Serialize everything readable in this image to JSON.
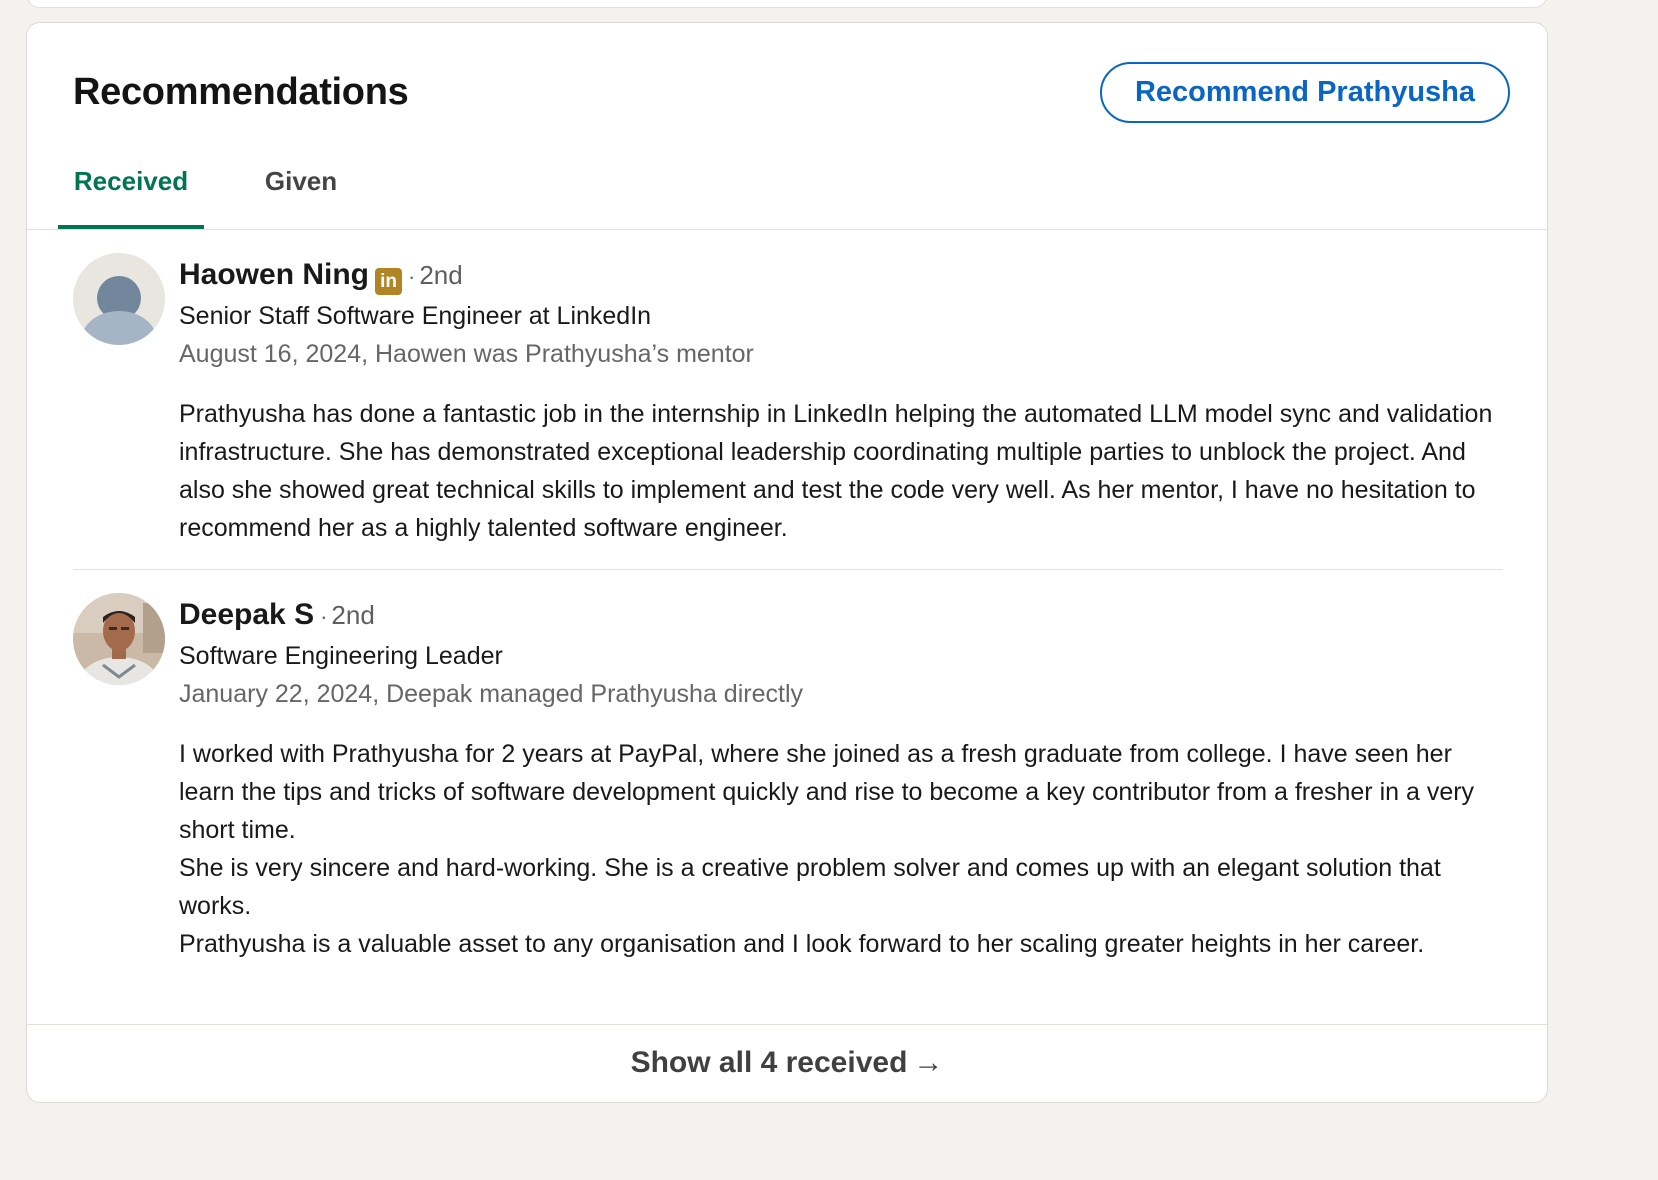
{
  "section": {
    "title": "Recommendations",
    "recommend_button": "Recommend Prathyusha"
  },
  "tabs": [
    {
      "label": "Received",
      "active": true
    },
    {
      "label": "Given",
      "active": false
    }
  ],
  "recommendations": [
    {
      "name": "Haowen Ning",
      "badge_icon": "linkedin-icon",
      "badge_text": "in",
      "degree": "2nd",
      "headline": "Senior Staff Software Engineer at LinkedIn",
      "meta": "August 16, 2024, Haowen was Prathyusha’s mentor",
      "text": "Prathyusha has done a fantastic job in the internship in LinkedIn helping the automated LLM model sync and validation infrastructure. She has demonstrated exceptional leadership coordinating multiple parties to unblock the project. And also she showed great technical skills to implement and test the code very well. As her mentor, I have no hesitation to recommend her as a highly talented software engineer."
    },
    {
      "name": "Deepak S",
      "degree": "2nd",
      "headline": "Software Engineering Leader",
      "meta": "January 22, 2024, Deepak managed Prathyusha directly",
      "text_lines": [
        "I worked with Prathyusha for 2 years at PayPal, where she joined as a fresh graduate from college. I have seen her learn the tips and tricks of software development quickly and rise to become a key contributor from a fresher in a very short time.",
        "She is very sincere and hard-working. She is a creative problem solver and comes up with an elegant solution that works.",
        "Prathyusha is a valuable asset to any organisation and I look forward to her scaling greater heights in her career."
      ]
    }
  ],
  "footer": {
    "label": "Show all 4 received",
    "arrow": "→"
  },
  "colors": {
    "accent": "#0a66c2",
    "active_tab": "#01754f",
    "badge": "#b18524",
    "page_bg": "#f4f2ee"
  }
}
